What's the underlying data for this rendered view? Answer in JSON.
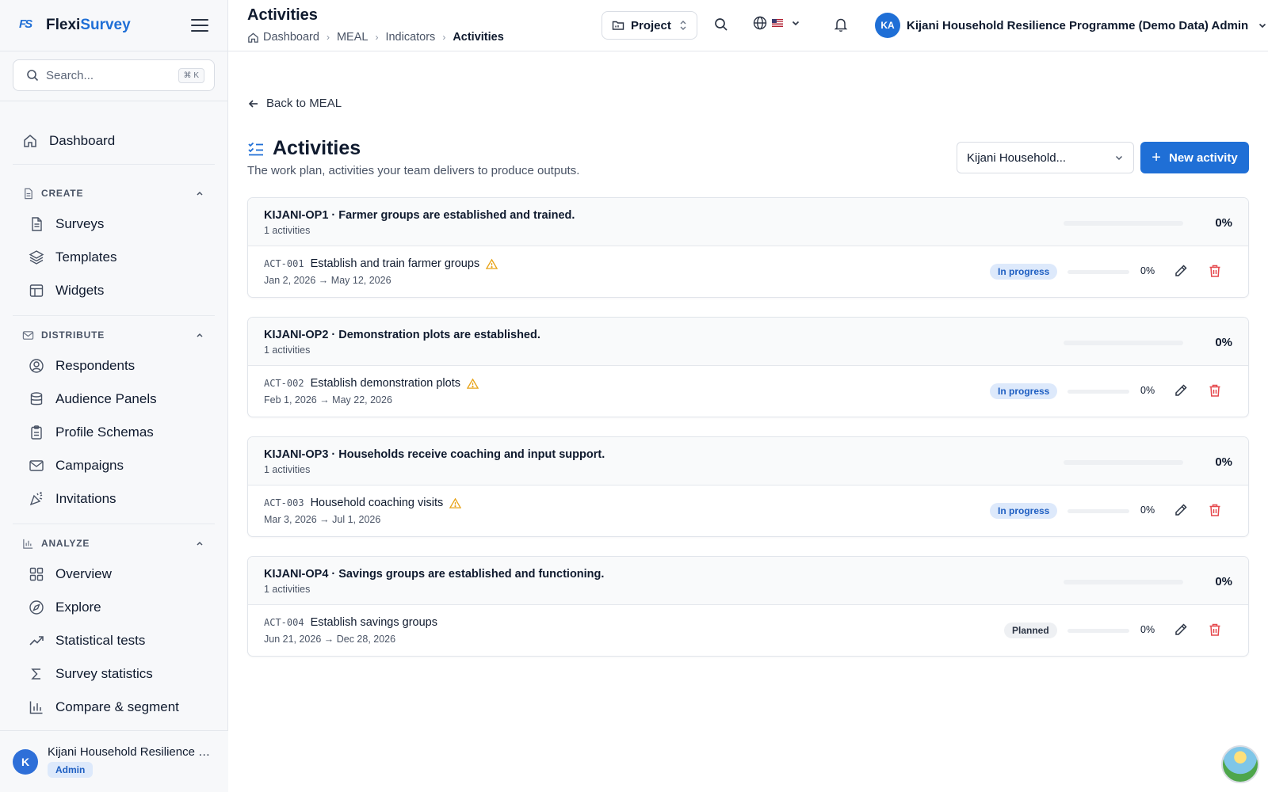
{
  "sidebar": {
    "brand_prefix": "Flexi",
    "brand_suffix": "Survey",
    "logo_text": "FS",
    "search_placeholder": "Search...",
    "search_shortcut": "⌘ K",
    "dashboard_label": "Dashboard",
    "sections": {
      "create": {
        "title": "CREATE",
        "items": [
          "Surveys",
          "Templates",
          "Widgets"
        ]
      },
      "distribute": {
        "title": "DISTRIBUTE",
        "items": [
          "Respondents",
          "Audience Panels",
          "Profile Schemas",
          "Campaigns",
          "Invitations"
        ]
      },
      "analyze": {
        "title": "ANALYZE",
        "items": [
          "Overview",
          "Explore",
          "Statistical tests",
          "Survey statistics",
          "Compare & segment"
        ]
      }
    },
    "footer": {
      "avatar_initial": "K",
      "name": "Kijani Household Resilience Pr...",
      "role": "Admin"
    }
  },
  "header": {
    "title": "Activities",
    "breadcrumb": [
      "Dashboard",
      "MEAL",
      "Indicators",
      "Activities"
    ],
    "breadcrumb_separator": "›",
    "project_label": "Project",
    "user_initials": "KA",
    "user_name": "Kijani Household Resilience Programme (Demo Data) Admin"
  },
  "main": {
    "back_label": "Back to MEAL",
    "page_title": "Activities",
    "subtitle": "The work plan, activities your team delivers to produce outputs.",
    "filter_value": "Kijani Household...",
    "new_button_label": "New activity",
    "groups": [
      {
        "title": "KIJANI-OP1 · Farmer groups are established and trained.",
        "count": "1 activities",
        "progress": 0,
        "pct": "0%",
        "activity": {
          "code": "ACT-001",
          "name": "Establish and train farmer groups",
          "warning": true,
          "dates": "Jan 2, 2026 → May 12, 2026",
          "status": "In progress",
          "progress": 0,
          "pct": "0%"
        }
      },
      {
        "title": "KIJANI-OP2 · Demonstration plots are established.",
        "count": "1 activities",
        "progress": 0,
        "pct": "0%",
        "activity": {
          "code": "ACT-002",
          "name": "Establish demonstration plots",
          "warning": true,
          "dates": "Feb 1, 2026 → May 22, 2026",
          "status": "In progress",
          "progress": 0,
          "pct": "0%"
        }
      },
      {
        "title": "KIJANI-OP3 · Households receive coaching and input support.",
        "count": "1 activities",
        "progress": 0,
        "pct": "0%",
        "activity": {
          "code": "ACT-003",
          "name": "Household coaching visits",
          "warning": true,
          "dates": "Mar 3, 2026 → Jul 1, 2026",
          "status": "In progress",
          "progress": 0,
          "pct": "0%"
        }
      },
      {
        "title": "KIJANI-OP4 · Savings groups are established and functioning.",
        "count": "1 activities",
        "progress": 0,
        "pct": "0%",
        "activity": {
          "code": "ACT-004",
          "name": "Establish savings groups",
          "warning": false,
          "dates": "Jun 21, 2026 → Dec 28, 2026",
          "status": "Planned",
          "progress": 0,
          "pct": "0%"
        }
      }
    ]
  },
  "colors": {
    "accent": "#1f6fd6",
    "warning": "#e8a317",
    "danger": "#e5484d",
    "status_in_progress_bg": "#dde9fb",
    "status_planned_bg": "#eef0f3"
  },
  "icons": {
    "logo": "flexisurvey-logo-icon",
    "menu": "hamburger-icon",
    "search": "search-icon",
    "dashboard": "home-icon",
    "create": "document-icon",
    "surveys": "file-text-icon",
    "templates": "layers-icon",
    "widgets": "layout-icon",
    "distribute": "mail-icon",
    "respondents": "user-circle-icon",
    "audience_panels": "database-icon",
    "profile_schemas": "clipboard-icon",
    "campaigns": "envelope-icon",
    "invitations": "party-popper-icon",
    "analyze": "bar-chart-icon",
    "overview": "grid-icon",
    "explore": "compass-icon",
    "statistical_tests": "trending-up-icon",
    "survey_statistics": "sigma-icon",
    "compare_segment": "column-chart-icon",
    "project": "folder-icon",
    "language": "globe-icon",
    "notifications": "bell-icon",
    "back": "arrow-left-icon",
    "activities": "list-checks-icon",
    "warning": "warning-triangle-icon",
    "edit": "pencil-icon",
    "delete": "trash-icon",
    "assistant": "assistant-avatar-icon"
  }
}
